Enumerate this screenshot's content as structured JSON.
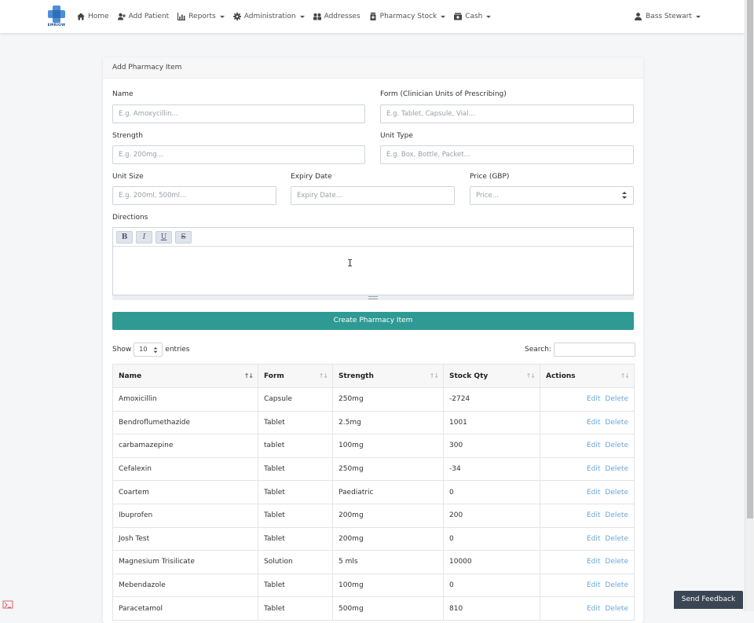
{
  "brand": {
    "logo_text": "EMRIOW",
    "accent": "#1d4e89"
  },
  "navbar": {
    "items": [
      {
        "label": "Home",
        "icon": "home-icon",
        "dropdown": false
      },
      {
        "label": "Add Patient",
        "icon": "add-user-icon",
        "dropdown": false
      },
      {
        "label": "Reports",
        "icon": "chart-icon",
        "dropdown": true
      },
      {
        "label": "Administration",
        "icon": "gear-icon",
        "dropdown": true
      },
      {
        "label": "Addresses",
        "icon": "map-icon",
        "dropdown": false
      },
      {
        "label": "Pharmacy Stock",
        "icon": "pharmacy-icon",
        "dropdown": true
      },
      {
        "label": "Cash",
        "icon": "cash-icon",
        "dropdown": true
      }
    ],
    "user_name": "Bass Stewart"
  },
  "form": {
    "title": "Add Pharmacy Item",
    "name_label": "Name",
    "name_placeholder": "E.g. Amoxycillin...",
    "form_label": "Form (Clinician Units of Prescribing)",
    "form_placeholder": "E.g. Tablet, Capsule, Vial...",
    "strength_label": "Strength",
    "strength_placeholder": "E.g. 200mg...",
    "unit_type_label": "Unit Type",
    "unit_type_placeholder": "E.g. Box, Bottle, Packet...",
    "unit_size_label": "Unit Size",
    "unit_size_placeholder": "E.g. 200ml, 500ml...",
    "expiry_label": "Expiry Date",
    "expiry_placeholder": "Expiry Date...",
    "price_label": "Price (GBP)",
    "price_placeholder": "Price...",
    "directions_label": "Directions",
    "editor_buttons": [
      "B",
      "I",
      "U",
      "S"
    ],
    "submit_label": "Create Pharmacy Item",
    "submit_color": "#2e9a93"
  },
  "table_controls": {
    "show_label": "Show",
    "entries_value": "10",
    "entries_label": "entries",
    "search_label": "Search:"
  },
  "table": {
    "columns": [
      "Name",
      "Form",
      "Strength",
      "Stock Qty",
      "Actions"
    ],
    "rows": [
      {
        "name": "Amoxicillin",
        "form": "Capsule",
        "strength": "250mg",
        "qty": "-2724"
      },
      {
        "name": "Bendroflumethazide",
        "form": "Tablet",
        "strength": "2.5mg",
        "qty": "1001"
      },
      {
        "name": "carbamazepine",
        "form": "tablet",
        "strength": "100mg",
        "qty": "300"
      },
      {
        "name": "Cefalexin",
        "form": "Tablet",
        "strength": "250mg",
        "qty": "-34"
      },
      {
        "name": "Coartem",
        "form": "Tablet",
        "strength": "Paediatric",
        "qty": "0"
      },
      {
        "name": "Ibuprofen",
        "form": "Tablet",
        "strength": "200mg",
        "qty": "200"
      },
      {
        "name": "Josh Test",
        "form": "Tablet",
        "strength": "200mg",
        "qty": "0"
      },
      {
        "name": "Magnesium Trisilicate",
        "form": "Solution",
        "strength": "5 mls",
        "qty": "10000"
      },
      {
        "name": "Mebendazole",
        "form": "Tablet",
        "strength": "100mg",
        "qty": "0"
      },
      {
        "name": "Paracetamol",
        "form": "Tablet",
        "strength": "500mg",
        "qty": "810"
      }
    ],
    "edit_label": "Edit",
    "delete_label": "Delete",
    "link_color": "#6aa7d8"
  },
  "feedback": {
    "label": "Send Feedback"
  }
}
